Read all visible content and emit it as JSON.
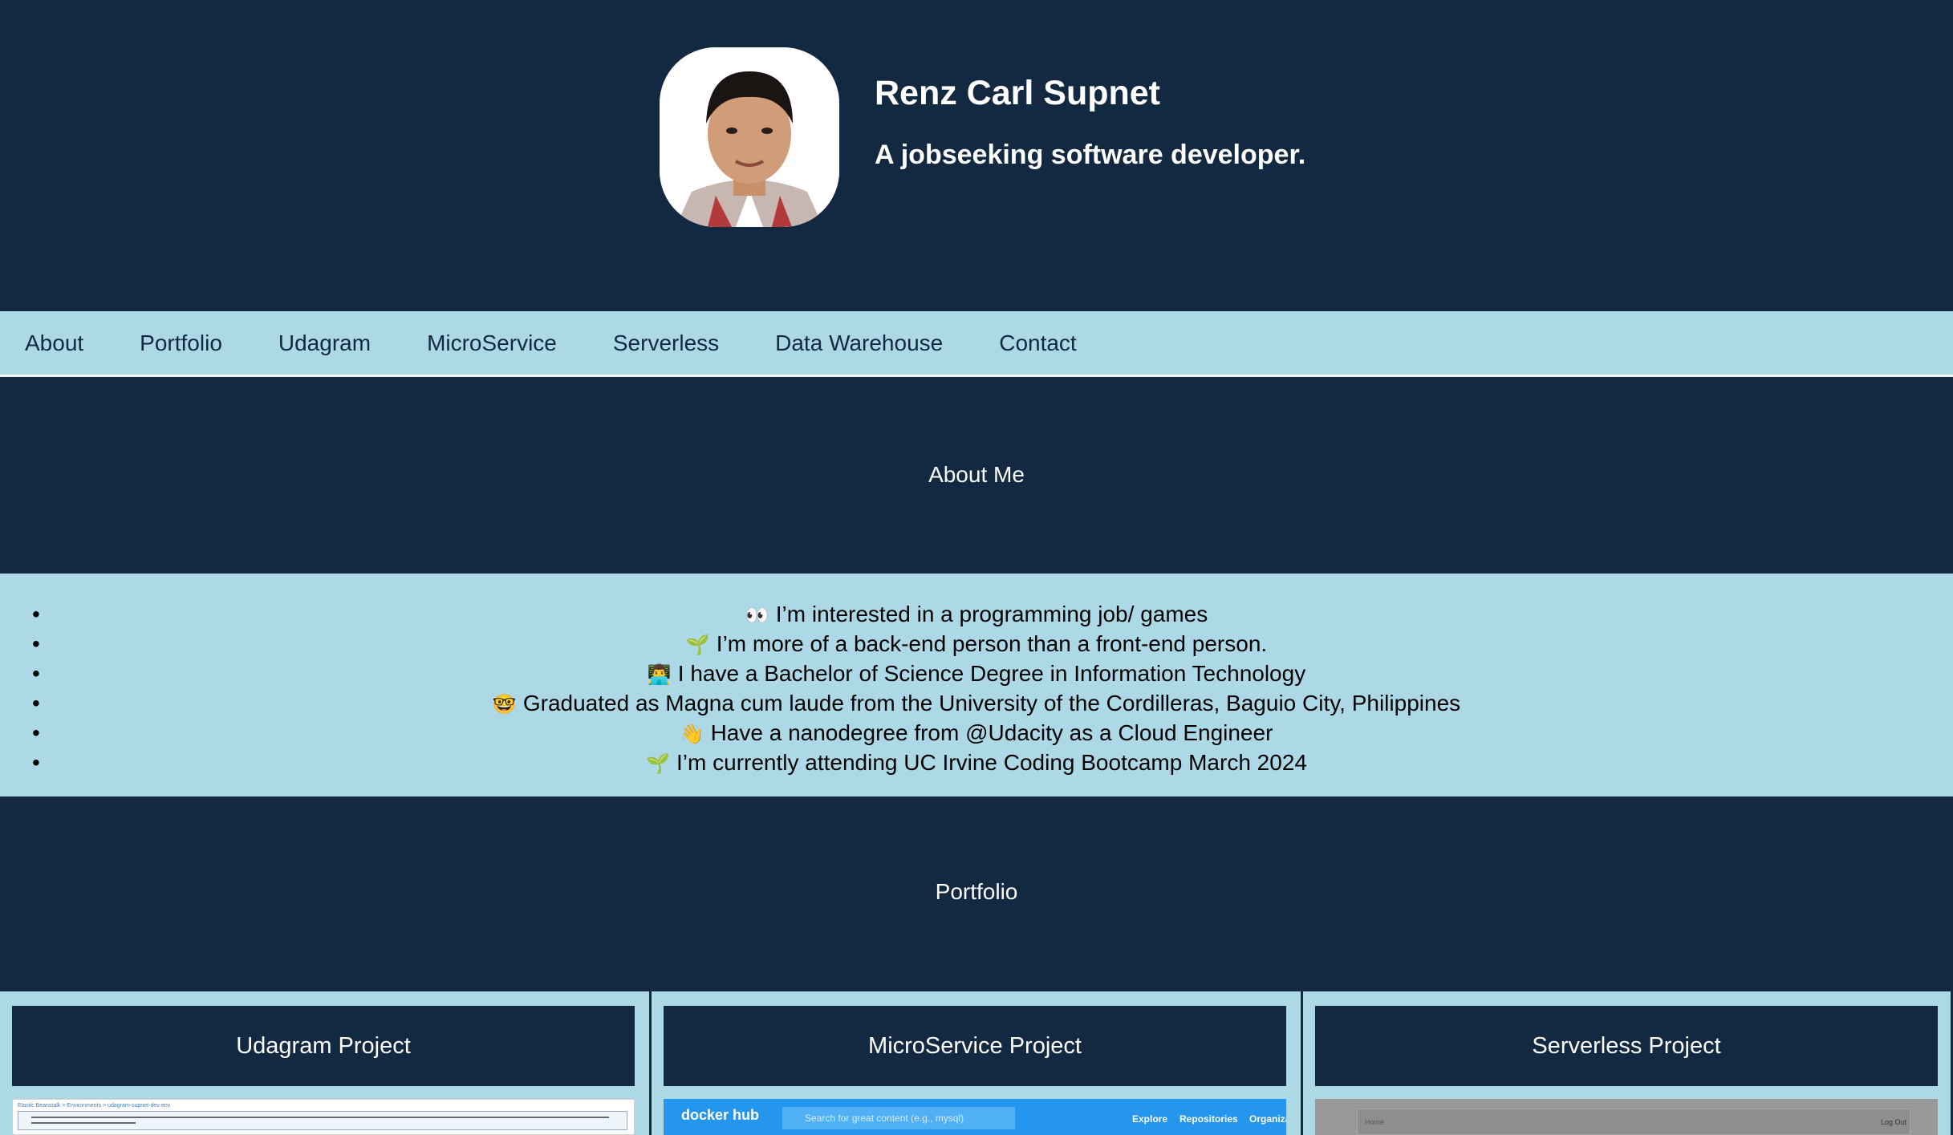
{
  "header": {
    "name": "Renz Carl Supnet",
    "tagline": "A jobseeking software developer."
  },
  "nav": {
    "items": [
      "About",
      "Portfolio",
      "Udagram",
      "MicroService",
      "Serverless",
      "Data Warehouse",
      "Contact"
    ]
  },
  "about": {
    "heading": "About Me",
    "items": [
      {
        "emoji": "👀",
        "text": "I’m interested in a programming job/ games"
      },
      {
        "emoji": "🌱",
        "text": "I’m more of a back-end person than a front-end person."
      },
      {
        "emoji": "👨‍💻",
        "text": "I have a Bachelor of Science Degree in Information Technology"
      },
      {
        "emoji": "🤓",
        "text": "Graduated as Magna cum laude from the University of the Cordilleras, Baguio City, Philippines"
      },
      {
        "emoji": "👋",
        "text": "Have a nanodegree from @Udacity as a Cloud Engineer"
      },
      {
        "emoji": "🌱",
        "text": "I’m currently attending UC Irvine Coding Bootcamp March 2024"
      }
    ]
  },
  "portfolio": {
    "heading": "Portfolio",
    "cards": [
      {
        "title": "Udagram Project"
      },
      {
        "title": "MicroService Project"
      },
      {
        "title": "Serverless Project"
      }
    ],
    "docker_shot": {
      "logo": "docker hub",
      "search_placeholder": "Search for great content (e.g., mysql)",
      "links": [
        "Explore",
        "Repositories",
        "Organiza"
      ]
    },
    "serverless_shot": {
      "home": "Home",
      "logout": "Log Out"
    }
  },
  "colors": {
    "navy": "#132941",
    "light_blue": "#add8e6"
  }
}
